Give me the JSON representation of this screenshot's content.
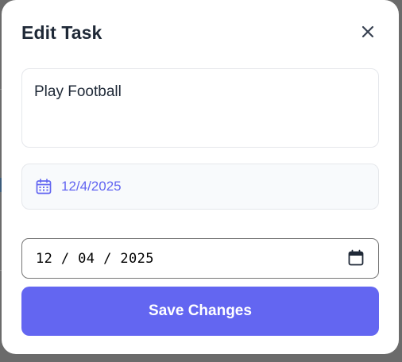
{
  "modal": {
    "title": "Edit Task",
    "close_icon": "close-icon"
  },
  "task": {
    "title_value": "Play Football"
  },
  "date_display": {
    "icon": "calendar-icon",
    "text": "12/4/2025",
    "color": "#6366f1"
  },
  "date_input": {
    "value": "12 / 04 / 2025",
    "picker_icon": "calendar-picker-icon"
  },
  "actions": {
    "save_label": "Save Changes",
    "save_color": "#6366f1"
  }
}
